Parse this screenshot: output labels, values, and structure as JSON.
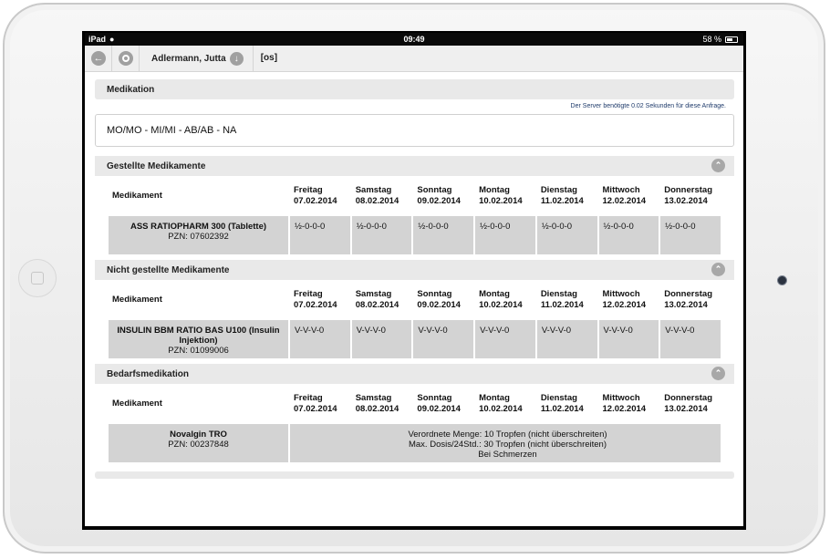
{
  "status_bar": {
    "device": "iPad",
    "time": "09:49",
    "battery": "58 %",
    "battery_level": 0.58
  },
  "toolbar": {
    "patient": "Adlermann, Jutta",
    "context": "[os]"
  },
  "header": {
    "title": "Medikation",
    "server_note": "Der Server benötigte 0.02 Sekunden für diese Anfrage."
  },
  "formula": "MO/MO - MI/MI - AB/AB - NA",
  "columns": {
    "medikament": "Medikament",
    "days": [
      {
        "day": "Freitag",
        "date": "07.02.2014"
      },
      {
        "day": "Samstag",
        "date": "08.02.2014"
      },
      {
        "day": "Sonntag",
        "date": "09.02.2014"
      },
      {
        "day": "Montag",
        "date": "10.02.2014"
      },
      {
        "day": "Dienstag",
        "date": "11.02.2014"
      },
      {
        "day": "Mittwoch",
        "date": "12.02.2014"
      },
      {
        "day": "Donnerstag",
        "date": "13.02.2014"
      }
    ]
  },
  "sections": [
    {
      "title": "Gestellte Medikamente",
      "row": {
        "name": "ASS RATIOPHARM 300 (Tablette)",
        "pzn": "PZN: 07602392",
        "doses": [
          "½-0-0-0",
          "½-0-0-0",
          "½-0-0-0",
          "½-0-0-0",
          "½-0-0-0",
          "½-0-0-0",
          "½-0-0-0"
        ]
      }
    },
    {
      "title": "Nicht gestellte Medikamente",
      "row": {
        "name": "INSULIN BBM RATIO BAS U100 (Insulin Injektion)",
        "pzn": "PZN: 01099006",
        "doses": [
          "V-V-V-0",
          "V-V-V-0",
          "V-V-V-0",
          "V-V-V-0",
          "V-V-V-0",
          "V-V-V-0",
          "V-V-V-0"
        ]
      }
    },
    {
      "title": "Bedarfsmedikation",
      "row": {
        "name": "Novalgin TRO",
        "pzn": "PZN: 00237848",
        "note": [
          "Verordnete Menge: 10 Tropfen (nicht überschreiten)",
          "Max. Dosis/24Std.: 30 Tropfen (nicht überschreiten)",
          "Bei Schmerzen"
        ]
      }
    }
  ]
}
